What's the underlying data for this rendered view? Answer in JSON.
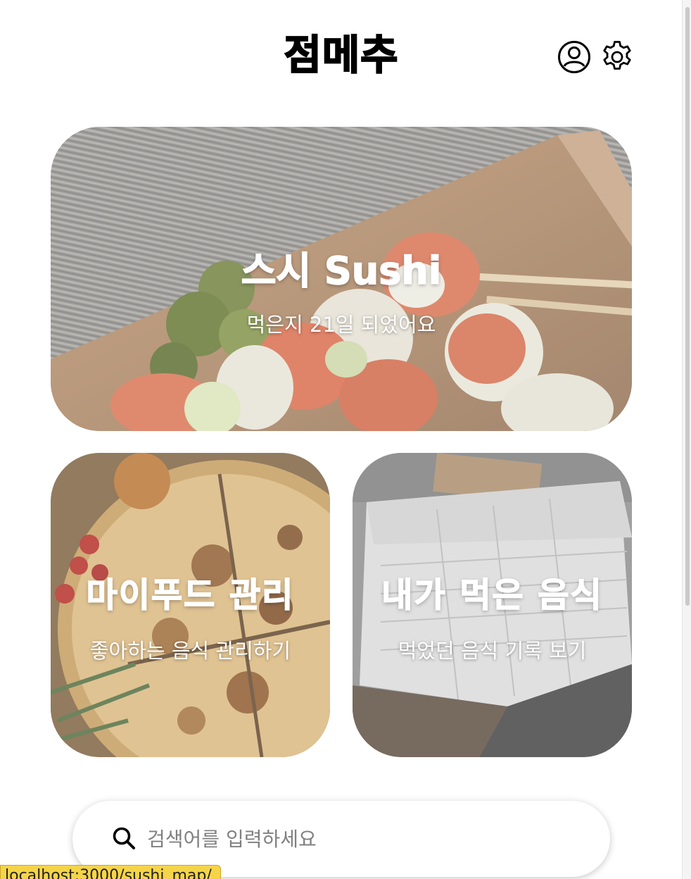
{
  "header": {
    "title": "점메추",
    "profile_icon": "user-circle-icon",
    "settings_icon": "gear-icon"
  },
  "recommendation": {
    "title": "스시 Sushi",
    "subtitle": "먹은지 21일 되었어요"
  },
  "my_food": {
    "title": "마이푸드 관리",
    "subtitle": "좋아하는 음식 관리하기"
  },
  "history": {
    "title": "내가 먹은 음식",
    "subtitle": "먹었던 음식 기록 보기"
  },
  "search": {
    "placeholder": "검색어를 입력하세요",
    "value": ""
  },
  "status_bar": {
    "url": "localhost:3000/sushi_map/"
  }
}
